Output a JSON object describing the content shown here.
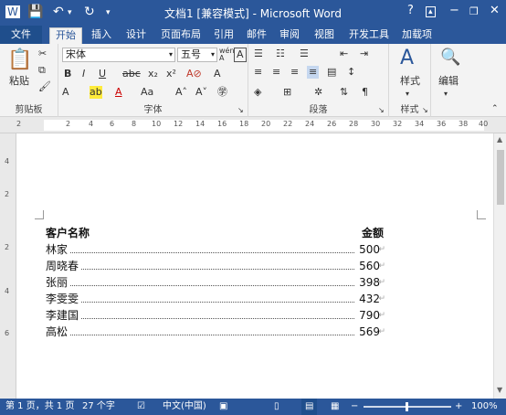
{
  "window": {
    "title": "文档1 [兼容模式] - Microsoft Word",
    "help": "?"
  },
  "tabs": [
    "文件",
    "开始",
    "插入",
    "设计",
    "页面布局",
    "引用",
    "邮件",
    "审阅",
    "视图",
    "开发工具",
    "加载项"
  ],
  "ribbon": {
    "paste_label": "粘贴",
    "font_name": "宋体",
    "font_size": "五号",
    "styles_label": "样式",
    "edit_label": "编辑",
    "groups": {
      "clipboard": "剪贴板",
      "font": "字体",
      "paragraph": "段落",
      "styles": "样式"
    }
  },
  "ruler": {
    "ticks": [
      "2",
      "2",
      "4",
      "6",
      "8",
      "10",
      "12",
      "14",
      "16",
      "18",
      "20",
      "22",
      "24",
      "26",
      "28",
      "30",
      "32",
      "34",
      "36",
      "38",
      "40"
    ]
  },
  "vruler": {
    "ticks": [
      "4",
      "2",
      "2",
      "4",
      "6"
    ]
  },
  "document": {
    "header": {
      "name": "客户名称",
      "value": "金额"
    },
    "rows": [
      {
        "name": "林家",
        "value": "500"
      },
      {
        "name": "周晓春",
        "value": "560"
      },
      {
        "name": "张丽",
        "value": "398"
      },
      {
        "name": "李雯雯",
        "value": "432"
      },
      {
        "name": "李建国",
        "value": "790"
      },
      {
        "name": "高松",
        "value": "569"
      }
    ],
    "para_mark": "↵"
  },
  "status": {
    "page": "第 1 页，共 1 页",
    "words": "27 个字",
    "language": "中文(中国)",
    "zoom": "100%",
    "minus": "−",
    "plus": "+"
  },
  "colors": {
    "accent": "#2b579a",
    "ribbon": "#f3f3f3"
  }
}
